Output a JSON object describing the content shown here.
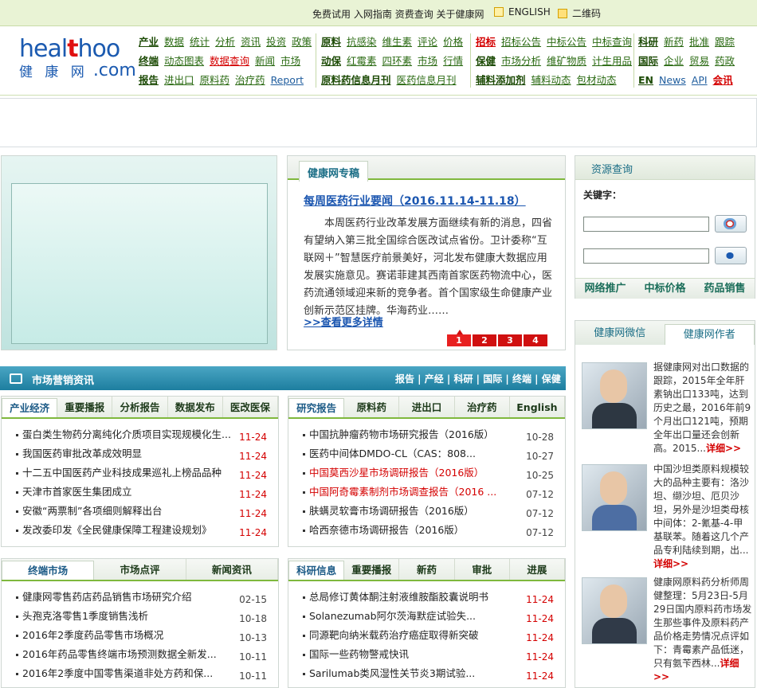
{
  "topbar": {
    "links": [
      "免费试用",
      "入网指南",
      "资费查询",
      "关于健康网"
    ],
    "home_label": "ENGLISH",
    "qr_label": "二维码"
  },
  "logo": {
    "en_a": "heal",
    "en_plus": "t",
    "en_b": "hoo",
    "cn": "健 康 网",
    "com": ".com"
  },
  "nav": {
    "g1": [
      [
        {
          "t": "产业",
          "s": "b"
        },
        {
          "t": "数据"
        },
        {
          "t": "统计"
        },
        {
          "t": "分析"
        },
        {
          "t": "资讯"
        },
        {
          "t": "投资"
        },
        {
          "t": "政策"
        }
      ],
      [
        {
          "t": "终端",
          "s": "b"
        },
        {
          "t": "动态图表"
        },
        {
          "t": "数据查询",
          "s": "r"
        },
        {
          "t": "新闻"
        },
        {
          "t": "市场"
        }
      ],
      [
        {
          "t": "报告",
          "s": "b"
        },
        {
          "t": "进出口"
        },
        {
          "t": "原料药"
        },
        {
          "t": "治疗药"
        },
        {
          "t": "Report",
          "s": "gray"
        }
      ]
    ],
    "g2": [
      [
        {
          "t": "原料",
          "s": "b"
        },
        {
          "t": "抗感染"
        },
        {
          "t": "维生素"
        },
        {
          "t": "评论"
        },
        {
          "t": "价格"
        }
      ],
      [
        {
          "t": "动保",
          "s": "b"
        },
        {
          "t": "红霉素"
        },
        {
          "t": "四环素"
        },
        {
          "t": "市场"
        },
        {
          "t": "行情"
        }
      ],
      [
        {
          "t": "原料药信息月刊",
          "s": "b"
        },
        {
          "t": "医药信息月刊"
        }
      ]
    ],
    "g3": [
      [
        {
          "t": "招标",
          "s": "rb"
        },
        {
          "t": "招标公告"
        },
        {
          "t": "中标公告"
        },
        {
          "t": "中标查询"
        }
      ],
      [
        {
          "t": "保健",
          "s": "b"
        },
        {
          "t": "市场分析"
        },
        {
          "t": "维矿物质"
        },
        {
          "t": "计生用品"
        }
      ],
      [
        {
          "t": "辅料添加剂",
          "s": "b"
        },
        {
          "t": "辅料动态"
        },
        {
          "t": "包材动态"
        }
      ]
    ],
    "g4": [
      [
        {
          "t": "科研",
          "s": "b"
        },
        {
          "t": "新药"
        },
        {
          "t": "批准"
        },
        {
          "t": "跟踪"
        }
      ],
      [
        {
          "t": "国际",
          "s": "b"
        },
        {
          "t": "企业"
        },
        {
          "t": "贸易"
        },
        {
          "t": "药政"
        }
      ],
      [
        {
          "t": "EN",
          "s": "b"
        },
        {
          "t": "News",
          "s": "gray"
        },
        {
          "t": "API",
          "s": "gray"
        },
        {
          "t": "会讯",
          "s": "rb"
        }
      ]
    ]
  },
  "special": {
    "tab": "健康网专稿",
    "title": "每周医药行业要闻（2016.11.14-11.18）",
    "body": "本周医药行业改革发展方面继续有新的消息，四省有望纳入第三批全国综合医改试点省份。卫计委称“互联网＋”智慧医疗前景美好，河北发布健康大数据应用发展实施意见。赛诺菲建其西南首家医药物流中心，医药流通领域迎来新的竞争者。首个国家级生命健康产业创新示范区挂牌。华海药业……",
    "more": ">>查看更多详情",
    "pages": [
      "1",
      "2",
      "3",
      "4"
    ]
  },
  "search": {
    "head": "资源查询",
    "keyword_label": "关键字：",
    "tabs": [
      "网络推广",
      "中标价格",
      "药品销售"
    ]
  },
  "weibo": {
    "tabs": [
      "健康网微信",
      "健康网作者"
    ],
    "items": [
      {
        "text": "据健康网对出口数据的跟踪，2015年全年肝素钠出口133吨，达到历史之最，2016年前9个月出口121吨，预期全年出口量还会创新高。2015...",
        "more": "详细>>"
      },
      {
        "text": "中国沙坦类原料规模较大的品种主要有：洛沙坦、缬沙坦、厄贝沙坦，另外是沙坦类母核中间体：2-氰基-4-甲基联苯。随着这几个产品专利陆续到期，出...",
        "more": "详细>>"
      },
      {
        "text": "健康网原料药分析师周健整理：5月23日-5月29日国内原料药市场发生那些事件及原料药产品价格走势情况点评如下：青霉素产品低迷，只有氨苄西林...",
        "more": "详细>>"
      }
    ]
  },
  "market": {
    "title": "市场营销资讯",
    "links": "报告 | 产经 | 科研 | 国际 | 终端 | 保健"
  },
  "box1": {
    "tabs": [
      "产业经济",
      "重要播报",
      "分析报告",
      "数据发布",
      "医改医保"
    ],
    "items": [
      {
        "t": "蛋白类生物药分离纯化介质项目实现规模化生...",
        "d": "11-24"
      },
      {
        "t": "我国医药审批改革成效明显",
        "d": "11-24"
      },
      {
        "t": "十二五中国医药产业科技成果巡礼上榜品品种",
        "d": "11-24"
      },
      {
        "t": "天津市首家医生集团成立",
        "d": "11-24"
      },
      {
        "t": "安徽“两票制”各项细则解释出台",
        "d": "11-24"
      },
      {
        "t": "发改委印发《全民健康保障工程建设规划》",
        "d": "11-24"
      }
    ]
  },
  "box2": {
    "tabs": [
      "研究报告",
      "原料药",
      "进出口",
      "治疗药",
      "English"
    ],
    "items": [
      {
        "t": "中国抗肿瘤药物市场研究报告（2016版）",
        "d": "10-28"
      },
      {
        "t": "医药中间体DMDO-CL（CAS：808...",
        "d": "10-27"
      },
      {
        "t": "中国莫西沙星市场调研报告（2016版）",
        "d": "10-25",
        "red": true
      },
      {
        "t": "中国阿奇霉素制剂市场调查报告（2016 ...",
        "d": "07-12",
        "red": true
      },
      {
        "t": "肤螨灵软膏市场调研报告（2016版）",
        "d": "07-12"
      },
      {
        "t": "哈西奈德市场调研报告（2016版）",
        "d": "07-12"
      }
    ]
  },
  "box3": {
    "tabs": [
      "终端市场",
      "市场点评",
      "新闻资讯"
    ],
    "items": [
      {
        "t": "健康网零售药店药品销售市场研究介绍",
        "d": "02-15"
      },
      {
        "t": "头孢克洛零售1季度销售浅析",
        "d": "10-18"
      },
      {
        "t": "2016年2季度药品零售市场概况",
        "d": "10-13"
      },
      {
        "t": "2016年药品零售终端市场预测数据全新发...",
        "d": "10-11"
      },
      {
        "t": "2016年2季度中国零售渠道非处方药和保...",
        "d": "10-11"
      }
    ]
  },
  "box4": {
    "tabs": [
      "科研信息",
      "重要播报",
      "新药",
      "审批",
      "进展"
    ],
    "items": [
      {
        "t": "总局修订黄体酮注射液维胺酯胶囊说明书",
        "d": "11-24"
      },
      {
        "t": "Solanezumab阿尔茨海默症试验失...",
        "d": "11-24"
      },
      {
        "t": "同源靶向纳米载药治疗癌症取得新突破",
        "d": "11-24"
      },
      {
        "t": "国际一些药物警戒快讯",
        "d": "11-24"
      },
      {
        "t": "Sarilumab类风湿性关节炎3期试验...",
        "d": "11-24"
      }
    ]
  }
}
